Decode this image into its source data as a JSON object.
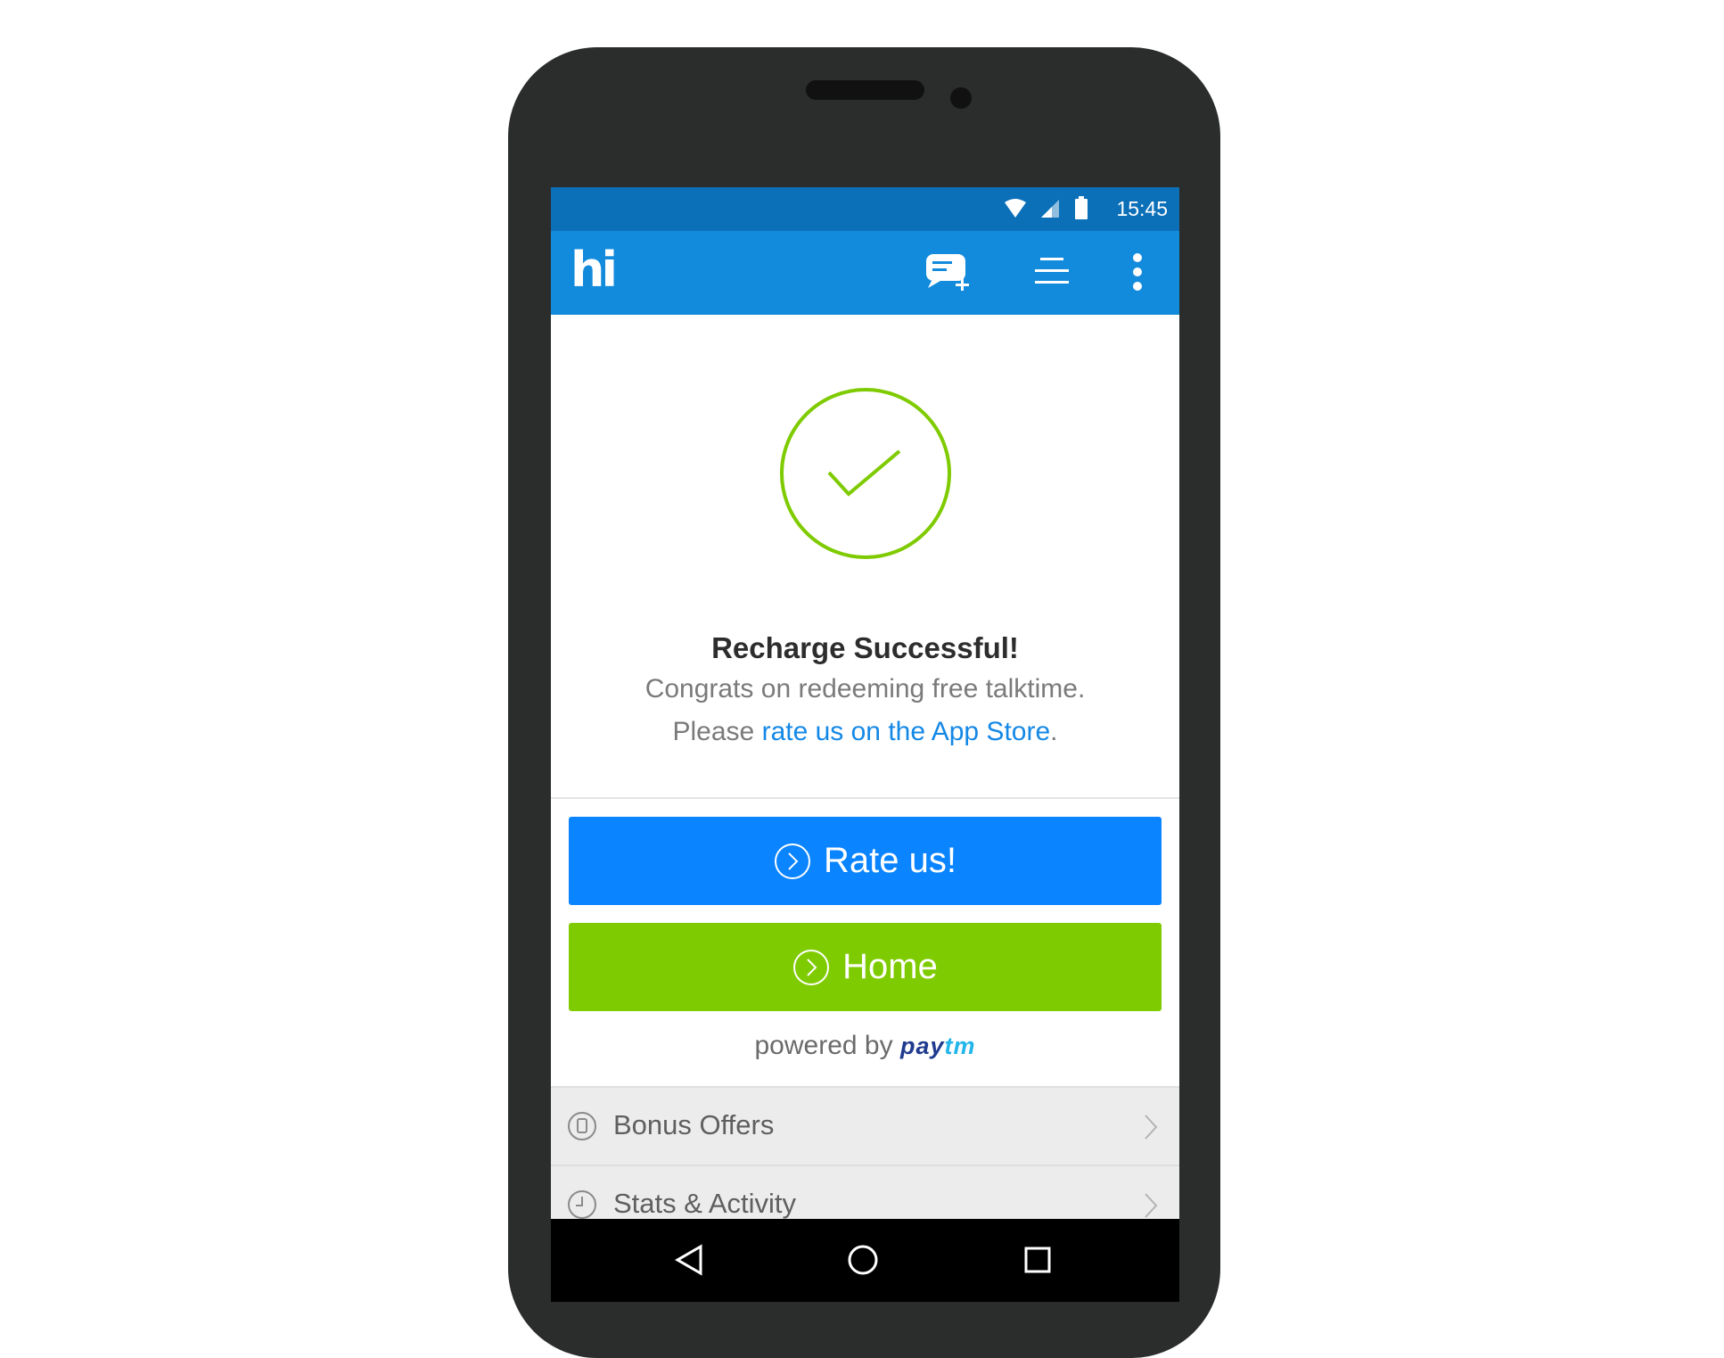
{
  "status_bar": {
    "time": "15:45",
    "icons": [
      "wifi-icon",
      "signal-icon",
      "battery-icon"
    ]
  },
  "app_bar": {
    "logo": "hi",
    "actions": [
      "new-message-icon",
      "menu-list-icon",
      "more-vert-icon"
    ]
  },
  "success": {
    "icon": "check-circle-icon",
    "title": "Recharge Successful!",
    "line1": "Congrats on redeeming free talktime.",
    "line2_prefix": "Please ",
    "line2_link": "rate us on the App Store",
    "line2_suffix": "."
  },
  "buttons": {
    "rate": "Rate us!",
    "home": "Home"
  },
  "powered": {
    "text": "powered by",
    "brand_pay": "pay",
    "brand_tm": "tm"
  },
  "list": [
    {
      "label": "Bonus Offers",
      "icon": "bonus-icon"
    },
    {
      "label": "Stats & Activity",
      "icon": "clock-icon"
    }
  ],
  "colors": {
    "status_bar": "#0c70b8",
    "app_bar": "#138bdc",
    "rate_button": "#0a84ff",
    "home_button": "#7fcb01",
    "success_green": "#7fcb01",
    "link": "#1488e6"
  }
}
